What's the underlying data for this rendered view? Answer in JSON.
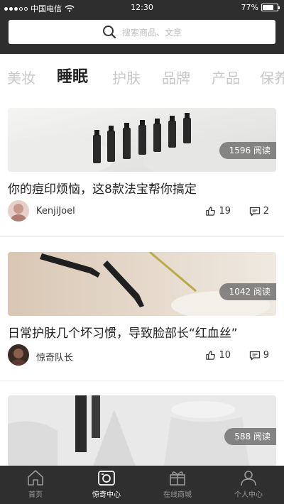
{
  "status_bar": {
    "carrier": "中国电信",
    "time": "12:30",
    "battery": "77%",
    "battery_level": 0.77
  },
  "search": {
    "placeholder": "搜索商品、文章",
    "icon": "search-icon"
  },
  "tabs": [
    {
      "label": "美妆",
      "active": false
    },
    {
      "label": "睡眠",
      "active": true
    },
    {
      "label": "护肤",
      "active": false
    },
    {
      "label": "品牌",
      "active": false
    },
    {
      "label": "产品",
      "active": false
    },
    {
      "label": "保养",
      "active": false
    }
  ],
  "articles": [
    {
      "reads": "1596 阅读",
      "title": "你的痘印烦恼，这8款法宝帮你搞定",
      "author": "KenjiJoel",
      "likes": "19",
      "comments": "2"
    },
    {
      "reads": "1042 阅读",
      "title": "日常护肤几个坏习惯，导致脸部长“红血丝”",
      "author": "惊奇队长",
      "likes": "10",
      "comments": "9"
    },
    {
      "reads": "588 阅读"
    }
  ],
  "bottom_nav": [
    {
      "label": "首页",
      "icon": "home-icon",
      "active": false
    },
    {
      "label": "惊奇中心",
      "icon": "camera-icon",
      "active": true
    },
    {
      "label": "在线商城",
      "icon": "gift-icon",
      "active": false
    },
    {
      "label": "个人中心",
      "icon": "person-icon",
      "active": false
    }
  ],
  "colors": {
    "dark_bar": "#2e2e2e",
    "tab_inactive": "#c8c8c8",
    "tab_active": "#222222"
  }
}
